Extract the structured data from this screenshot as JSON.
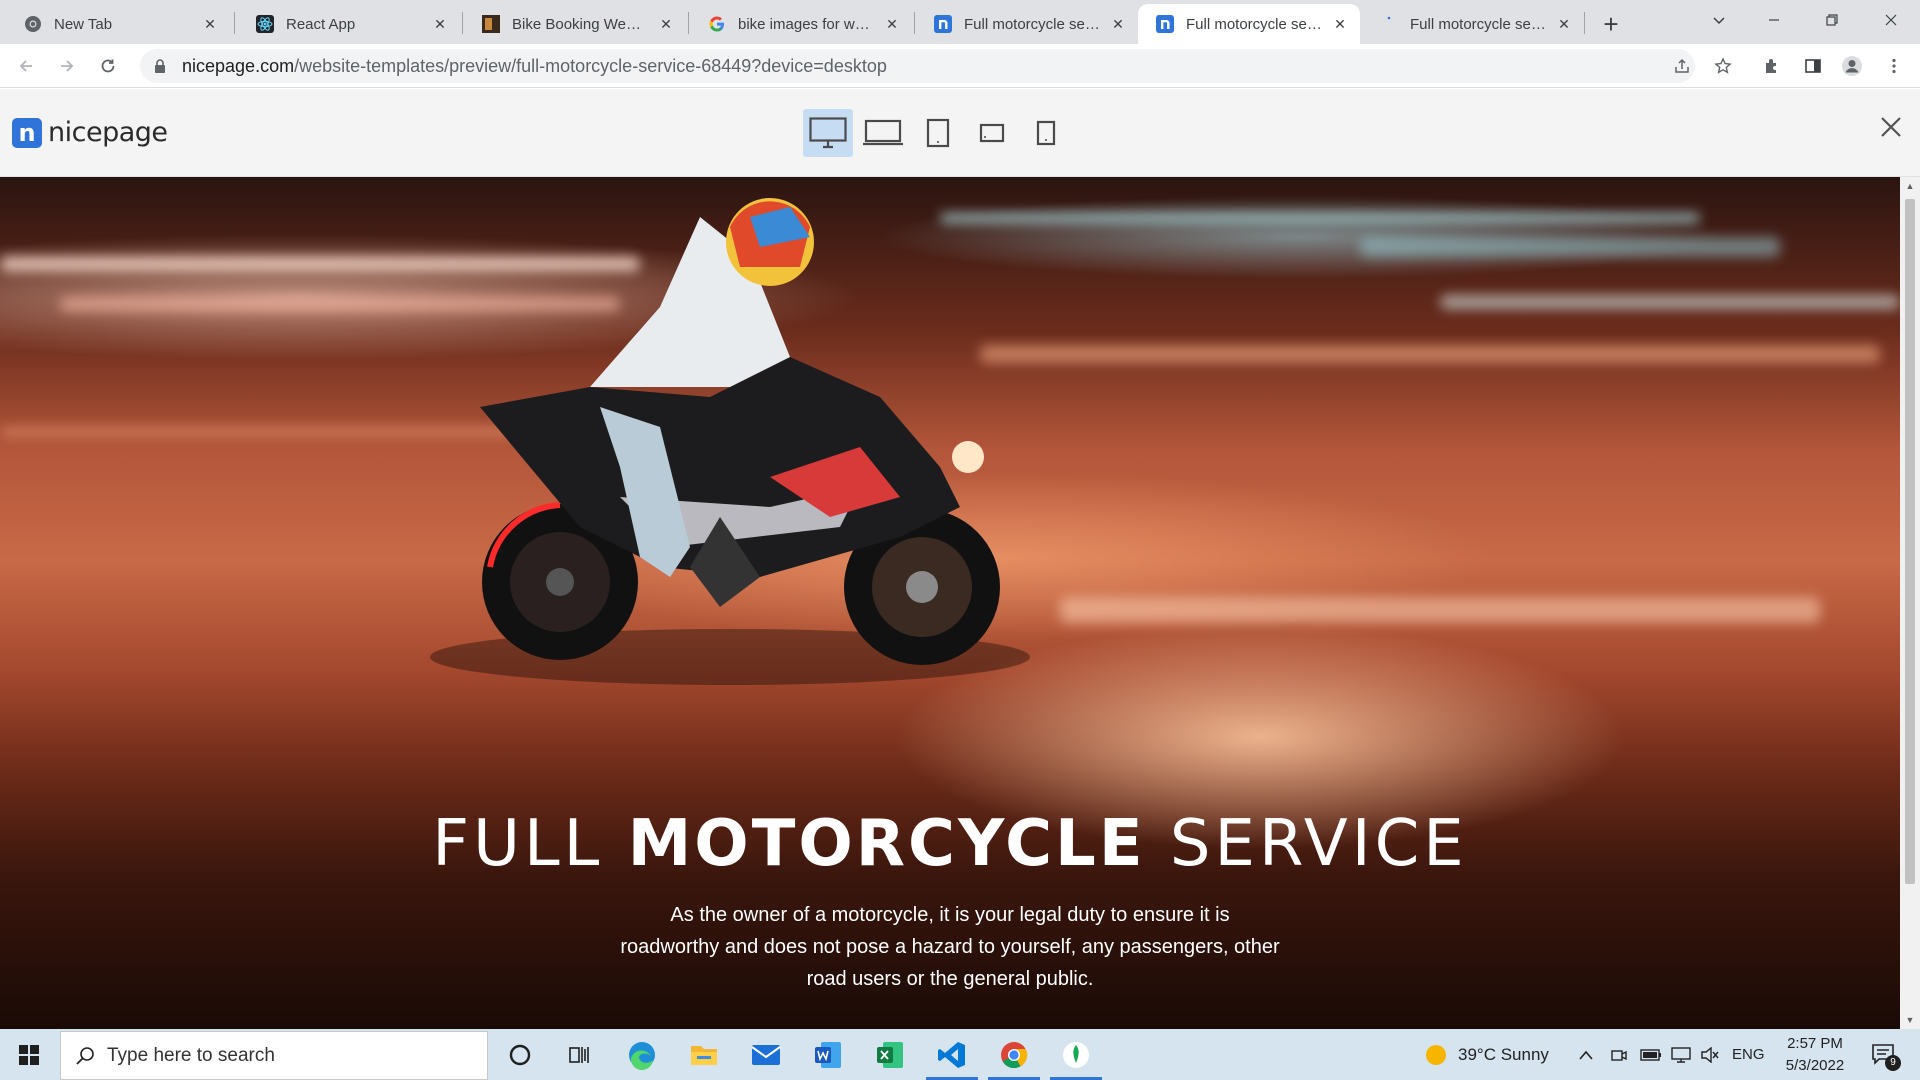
{
  "browser": {
    "tabs": [
      {
        "title": "New Tab",
        "icon": "chrome-icon",
        "active": false
      },
      {
        "title": "React App",
        "icon": "react-icon",
        "active": false
      },
      {
        "title": "Bike Booking Website",
        "icon": "site-thumbnail-icon",
        "active": false
      },
      {
        "title": "bike images for website",
        "icon": "google-icon",
        "active": false
      },
      {
        "title": "Full motorcycle service",
        "icon": "nicepage-icon",
        "active": false
      },
      {
        "title": "Full motorcycle service",
        "icon": "nicepage-icon",
        "active": true
      },
      {
        "title": "Full motorcycle service",
        "icon": "loading-icon",
        "active": false
      }
    ],
    "url_host": "nicepage.com",
    "url_path": "/website-templates/preview/full-motorcycle-service-68449?device=desktop"
  },
  "nicepage": {
    "logo_text": "nicepage",
    "devices": [
      "desktop",
      "laptop",
      "tablet",
      "tablet-landscape",
      "phone"
    ],
    "active_device": "desktop"
  },
  "hero": {
    "title_light_1": "FULL ",
    "title_bold": "MOTORCYCLE",
    "title_light_2": " SERVICE",
    "text": "As the owner of a motorcycle, it is your legal duty to ensure it is roadworthy and does not pose a hazard to yourself, any passengers, other road users or the general public."
  },
  "taskbar": {
    "search_placeholder": "Type here to search",
    "apps": [
      "cortana-icon",
      "task-view-icon",
      "edge-icon",
      "file-explorer-icon",
      "mail-icon",
      "word-icon",
      "excel-icon",
      "vscode-icon",
      "chrome-icon",
      "mongodb-compass-icon"
    ],
    "weather": "39°C  Sunny",
    "language": "ENG",
    "time": "2:57 PM",
    "date": "5/3/2022",
    "notification_count": "9"
  },
  "colors": {
    "accent": "#2f74d8",
    "tab_strip": "#dfe1e5",
    "taskbar": "#d6e4f0",
    "device_active": "#c6dcf3"
  }
}
